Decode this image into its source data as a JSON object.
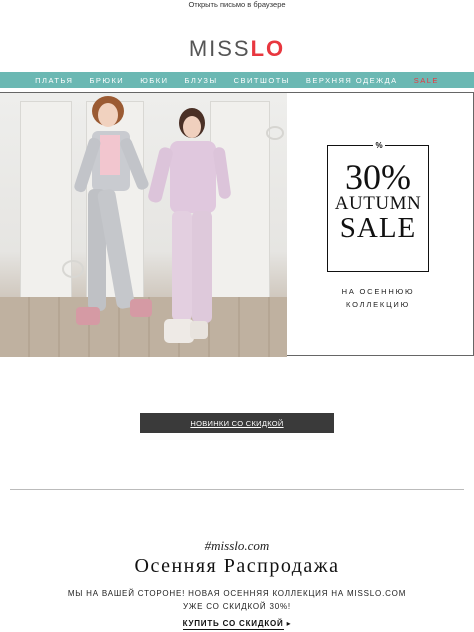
{
  "preheader": {
    "link": "Открыть письмо в браузере"
  },
  "brand": {
    "logo_text_a": "MISS",
    "logo_text_b": "LO",
    "accent": "#e8373f"
  },
  "nav": {
    "bg": "#6bb8b3",
    "items": [
      "ПЛАТЬЯ",
      "БРЮКИ",
      "ЮБКИ",
      "БЛУЗЫ",
      "СВИТШОТЫ",
      "ВЕРХНЯЯ ОДЕЖДА",
      "SALE"
    ]
  },
  "hero": {
    "image_alt": "",
    "promo": {
      "percent_mark": "%",
      "big": "30%",
      "line1": "AUTUMN",
      "line2": "SALE",
      "sub_line1": "НА ОСЕННЮЮ",
      "sub_line2": "КОЛЛЕКЦИЮ"
    }
  },
  "cta_button": {
    "label": "НОВИНКИ СО СКИДКОЙ",
    "bg": "#3a3a3a"
  },
  "section": {
    "hashtag": "#misslo.com",
    "title": "Осенняя Распродажа",
    "line1": "МЫ НА ВАШЕЙ СТОРОНЕ! НОВАЯ ОСЕННЯЯ КОЛЛЕКЦИЯ НА MISSLO.COM",
    "line2": "УЖЕ СО СКИДКОЙ 30%!",
    "buy_label": "КУПИТЬ СО СКИДКОЙ",
    "buy_arrow": "▸"
  }
}
